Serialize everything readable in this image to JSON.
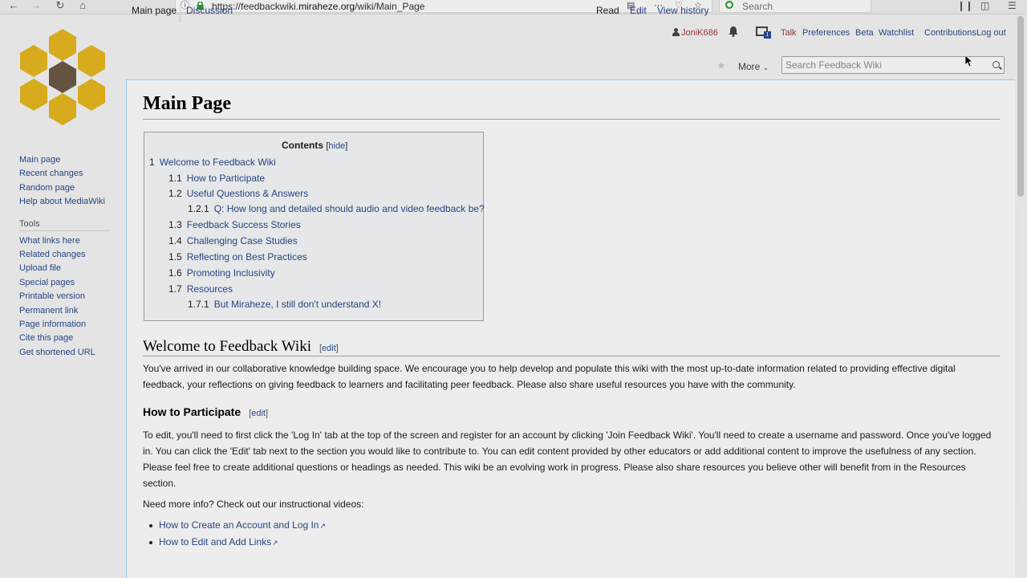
{
  "browser": {
    "url_prefix": "https://feedbackwiki.",
    "url_host": "miraheze.org",
    "url_path": "/wiki/Main_Page",
    "search_placeholder": "Search"
  },
  "personal": {
    "username": "JoniK686",
    "notif_count": "1",
    "links": [
      "Talk",
      "Preferences",
      "Beta",
      "Watchlist",
      "Contributions",
      "Log out"
    ]
  },
  "sidebar": {
    "nav": [
      "Main page",
      "Recent changes",
      "Random page",
      "Help about MediaWiki"
    ],
    "tools_heading": "Tools",
    "tools": [
      "What links here",
      "Related changes",
      "Upload file",
      "Special pages",
      "Printable version",
      "Permanent link",
      "Page information",
      "Cite this page",
      "Get shortened URL"
    ]
  },
  "tabs": {
    "main_page": "Main page",
    "discussion": "Discussion",
    "read": "Read",
    "edit": "Edit",
    "view_history": "View history",
    "more": "More",
    "search_placeholder": "Search Feedback Wiki"
  },
  "page": {
    "title": "Main Page"
  },
  "toc": {
    "title": "Contents",
    "hide_open": "[",
    "hide": "hide",
    "hide_close": "]",
    "items": [
      {
        "num": "1",
        "text": "Welcome to Feedback Wiki"
      },
      {
        "num": "1.1",
        "text": "How to Participate"
      },
      {
        "num": "1.2",
        "text": "Useful Questions & Answers"
      },
      {
        "num": "1.2.1",
        "text": "Q: How long and detailed should audio and video feedback be?"
      },
      {
        "num": "1.3",
        "text": "Feedback Success Stories"
      },
      {
        "num": "1.4",
        "text": "Challenging Case Studies"
      },
      {
        "num": "1.5",
        "text": "Reflecting on Best Practices"
      },
      {
        "num": "1.6",
        "text": "Promoting Inclusivity"
      },
      {
        "num": "1.7",
        "text": "Resources"
      },
      {
        "num": "1.7.1",
        "text": "But Miraheze, I still don't understand X!"
      }
    ]
  },
  "sections": {
    "welcome_heading": "Welcome to Feedback Wiki",
    "edit_open": "[",
    "edit": "edit",
    "edit_close": "]",
    "welcome_text": "You've arrived in our collaborative knowledge building space. We encourage you to help develop and populate this wiki with the most up-to-date information related to providing effective digital feedback, your reflections on giving feedback to learners and facilitating peer feedback. Please also share useful resources you have with the community.",
    "participate_heading": "How to Participate",
    "participate_text": "To edit, you'll need to first click the 'Log In' tab at the top of the screen and register for an account by clicking 'Join Feedback Wiki'. You'll need to create a username and password. Once you've logged in. You can click the 'Edit' tab next to the section you would like to contribute to. You can edit content provided by other educators or add additional content to improve the usefulness of any section. Please feel free to create additional questions or headings as needed. This wiki be an evolving work in progress. Please also share resources you believe other will benefit from in the Resources section.",
    "more_info": "Need more info? Check out our instructional videos:",
    "videos": [
      "How to Create an Account and Log In",
      "How to Edit and Add Links"
    ]
  },
  "colors": {
    "link": "#2a4b8d",
    "red_link": "#a53a3a",
    "logo_gold": "#e8b820",
    "logo_brown": "#6b5a45"
  }
}
